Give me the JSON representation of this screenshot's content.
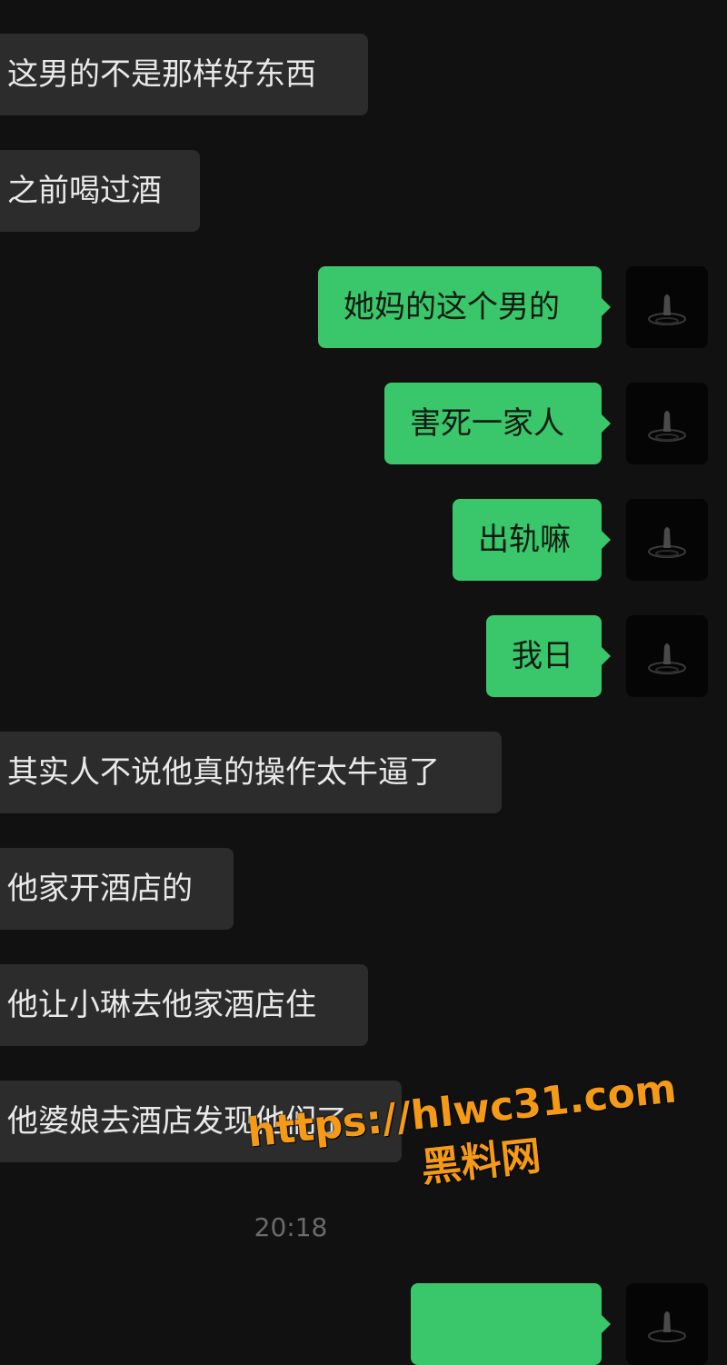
{
  "messages": {
    "m1": "这男的不是那样好东西",
    "m2": "之前喝过酒",
    "m3": "她妈的这个男的",
    "m4": "害死一家人",
    "m5": "出轨嘛",
    "m6": "我日",
    "m7": "其实人不说他真的操作太牛逼了",
    "m8": "他家开酒店的",
    "m9": "他让小琳去他家酒店住",
    "m10": "他婆娘去酒店发现他们了",
    "m11": ""
  },
  "timestamp": "20:18",
  "watermark": {
    "url": "https://hlwc31.com",
    "site": "黑料网"
  },
  "colors": {
    "background": "#111111",
    "incoming_bubble": "#2c2c2c",
    "outgoing_bubble": "#3ac66a",
    "watermark": "#f49a16"
  },
  "icons": {
    "avatar": "water-drop-avatar-icon"
  }
}
